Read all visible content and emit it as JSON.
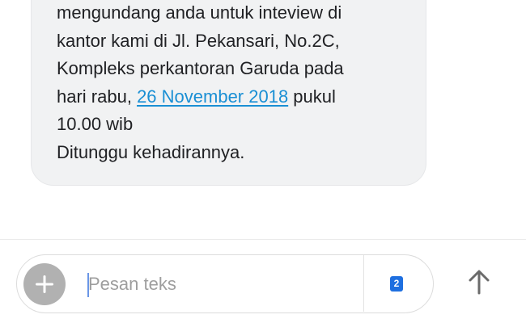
{
  "message": {
    "lines": [
      "mengundang anda untuk inteview di",
      "kantor kami di Jl. Pekansari, No.2C,",
      "Kompleks perkantoran Garuda pada",
      "10.00 wib",
      "Ditunggu kehadirannya."
    ],
    "line4_before": "hari rabu, ",
    "line4_link": "26 November 2018",
    "line4_after": " pukul"
  },
  "compose": {
    "placeholder": "Pesan teks",
    "value": "",
    "sim_number": "2",
    "attach_icon": "plus-icon",
    "send_icon": "arrow-up-icon"
  },
  "colors": {
    "bubble": "#f1f2f3",
    "link": "#1a8fd4",
    "attach_button": "#b1b1b1",
    "sim_badge": "#1e6fe0",
    "send_icon": "#6b6b6b"
  }
}
